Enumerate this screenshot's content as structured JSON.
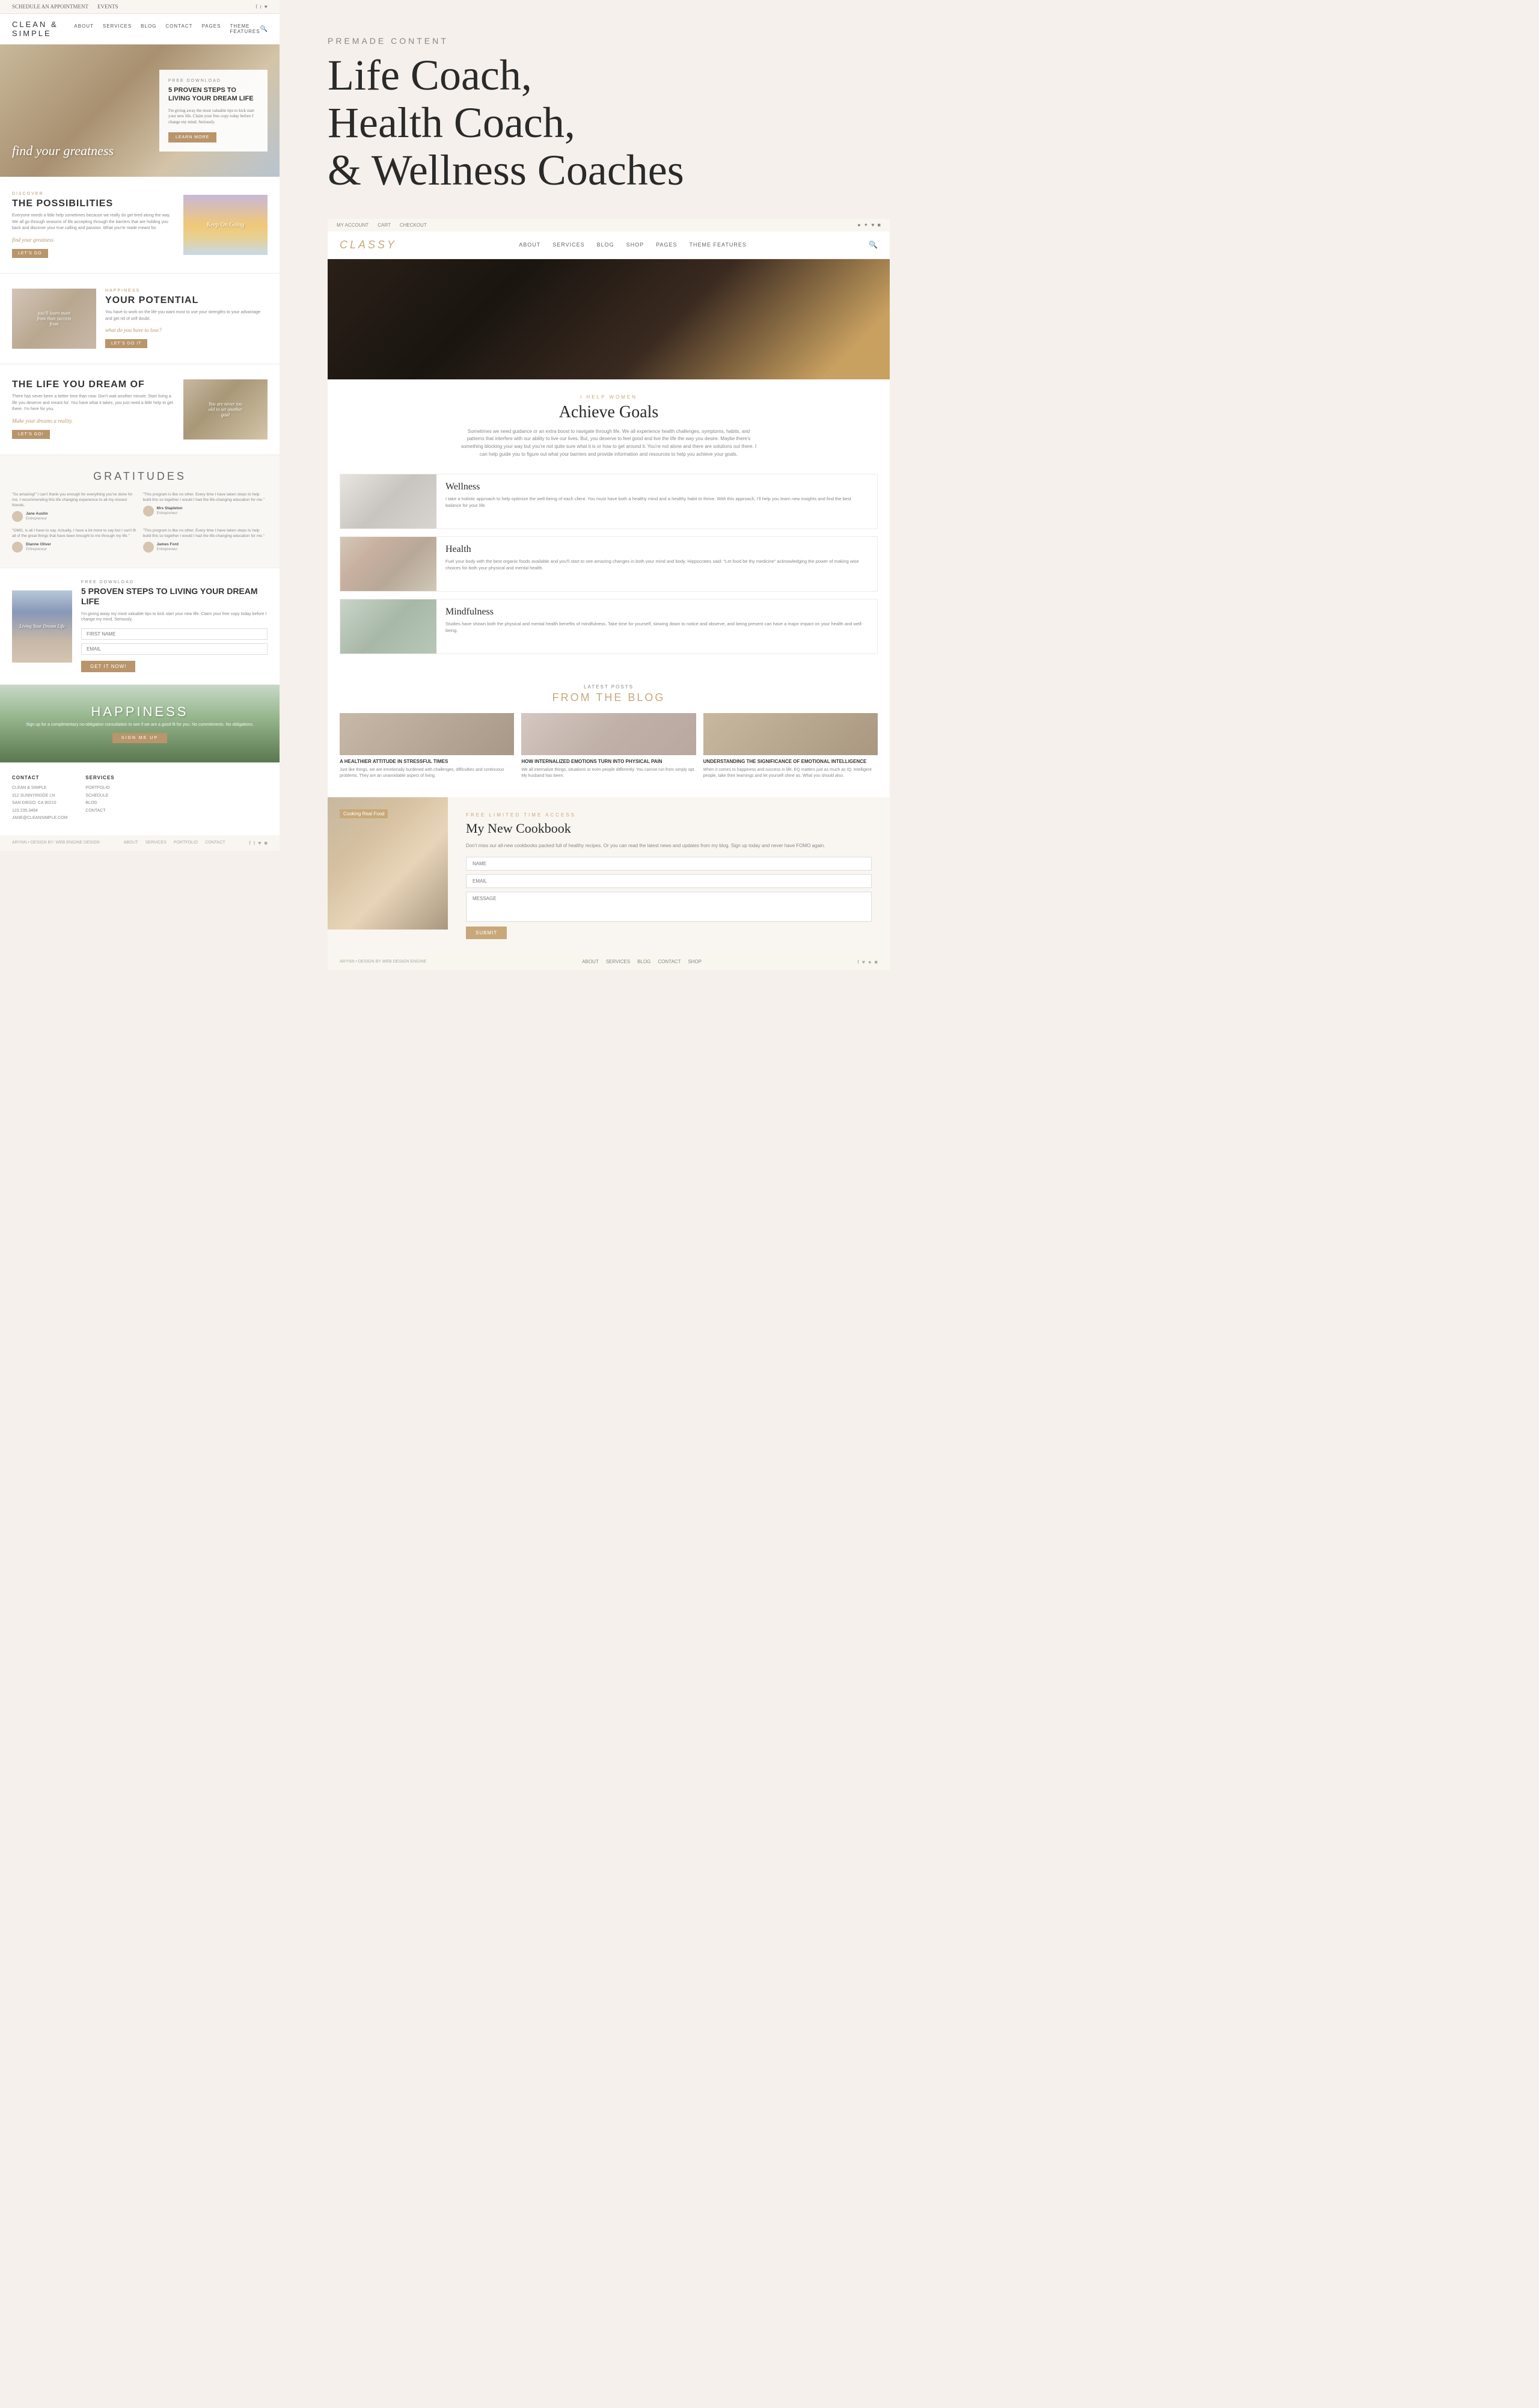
{
  "left": {
    "topbar": {
      "left_link": "SCHEDULE AN APPOINTMENT",
      "right_link": "EVENTS",
      "social_icons": "f t ♥"
    },
    "nav": {
      "logo": "CLEAN & SIMPLE",
      "links": [
        "ABOUT",
        "SERVICES",
        "BLOG",
        "CONTACT",
        "PAGES",
        "THEME FEATURES"
      ]
    },
    "hero": {
      "italic_text": "find your greatness",
      "box": {
        "label": "FREE DOWNLOAD",
        "title": "5 PROVEN STEPS TO LIVING YOUR DREAM LIFE",
        "text": "I'm giving away the most valuable tips to kick start your new life. Claim your free copy today before I change my mind. Seriously.",
        "button": "LEARN MORE"
      }
    },
    "sections": [
      {
        "tag": "DISCOVER",
        "title": "THE POSSIBILITIES",
        "text": "Everyone needs a little help sometimes because we really do get tired along the way. We all go through seasons of life accepting through the barriers that are holding you back and discover your true calling and passion. What you're made meant for.",
        "italic": "find your greatness",
        "cta_label": "",
        "button": "LET'S GO",
        "img_overlay": "Keep On Going",
        "img_type": "img-sunset",
        "reverse": false
      },
      {
        "tag": "HAPPINESS",
        "title": "YOUR POTENTIAL",
        "text": "You have to work on the life you want most to use your strengths to your advantage and get rid of self doubt.",
        "italic": "what do you have to lose?",
        "cta_label": "",
        "button": "LET'S DO IT",
        "img_overlay": "you'll learn more from than success from",
        "img_type": "img-person",
        "reverse": true
      },
      {
        "tag": "",
        "title": "THE LIFE YOU DREAM OF",
        "text": "There has never been a better time than now. Don't wait another minute. Start living a life you deserve and meant for. You have what it takes, you just need a little help to get there. I'm here for you.",
        "italic": "Make your dreams a reality.",
        "cta_label": "",
        "button": "LET'S GO!",
        "img_overlay": "You are never too old to set another goal",
        "img_type": "img-woman-desk",
        "reverse": false
      }
    ],
    "gratitudes": {
      "section_title": "GRATITUDES",
      "testimonials": [
        {
          "text": "\"So amazing!\" I can't thank you enough for everything you've done for me. I recommending this life changing experience to all my closest friends.",
          "name": "Jane Austin",
          "role": "Entrepreneur"
        },
        {
          "text": "\"This program is like no other. Every time I have taken steps to help build this so together I would I had the life-changing education for me.\"",
          "name": "Mrs Stapleton",
          "role": "Entrepreneur"
        },
        {
          "text": "\"OMG, is all I have to say. Actually, I have a lot more to say but I can't fit all of the great things that have been brought to me through my life.\"",
          "name": "Dianne Oliver",
          "role": "Entrepreneur"
        },
        {
          "text": "\"This program is like no other. Every time I have taken steps to help build this so together I would I had the life-changing education for me.\"",
          "name": "James Ford",
          "role": "Entrepreneur"
        }
      ]
    },
    "cta": {
      "free_label": "FREE DOWNLOAD",
      "title": "5 PROVEN STEPS TO LIVING YOUR DREAM LIFE",
      "text": "I'm giving away my most valuable tips to kick start your new life. Claim your free copy today before I change my mind. Seriously.",
      "first_name_placeholder": "FIRST NAME",
      "email_placeholder": "EMAIL",
      "button": "GET IT NOW!",
      "book_text": "Living Your Dream Life"
    },
    "happiness": {
      "title": "HAPPINESS",
      "text": "Sign up for a complimentary no-obligation consultation to see if we are a good fit for you. No commitments. No obligations.",
      "button": "SIGN ME UP"
    },
    "footer": {
      "contact_label": "CONTACT",
      "company": "CLEAN & SIMPLE",
      "address1": "312 SUNNYRIDGE LN",
      "address2": "SAN DIEGO, CA 90210",
      "phone": "123.235.3464",
      "email": "JANE@CLEANSIMPLE.COM",
      "services_label": "SERVICES",
      "services": [
        "PORTFOLIO",
        "SCHEDULE",
        "BLOG",
        "CONTACT"
      ],
      "copyright": "ARYNN • DESIGN BY: WEB ENGINE DESIGN",
      "footer_links": [
        "ABOUT",
        "SERVICES",
        "PORTFOLIO",
        "CONTACT"
      ]
    }
  },
  "right": {
    "header": {
      "premade_label": "PREMADE CONTENT",
      "title_line1": "Life Coach,",
      "title_line2": "Health Coach,",
      "title_line3": "& Wellness Coaches"
    },
    "classy": {
      "topbar": {
        "left_links": [
          "MY ACCOUNT",
          "CART",
          "CHECKOUT"
        ],
        "social_icons": "● ✦ ♥ ■"
      },
      "nav": {
        "logo": "CLASSY",
        "links": [
          "ABOUT",
          "SERVICES",
          "BLOG",
          "SHOP",
          "PAGES",
          "THEME FEATURES"
        ]
      },
      "hero_overlay_text": "",
      "achieve": {
        "label": "I HELP WOMEN",
        "title": "Achieve Goals",
        "text": "Sometimes we need guidance or an extra boost to navigate through life. We all experience health challenges, symptoms, habits, and patterns that interfere with our ability to live our lives. But, you deserve to feel good and live the life the way you desire. Maybe there's something blocking your way but you're not quite sure what it is or how to get around it. You're not alone and there are solutions out there. I can help guide you to figure out what your barriers and provide information and resources to help you achieve your goals."
      },
      "services": [
        {
          "title": "Wellness",
          "text": "I take a holistic approach to help optimize the well-being of each client. You must have both a healthy mind and a healthy habit to thrive. With this approach, I'll help you learn new insights and find the best balance for your life.",
          "img_type": "img-yoga"
        },
        {
          "title": "Health",
          "text": "Fuel your body with the best organic foods available and you'll start to see amazing changes in both your mind and body. Hippocrates said: \"Let food be thy medicine\" acknowledging the power of making wise choices for both your physical and mental health.",
          "img_type": "img-food"
        },
        {
          "title": "Mindfulness",
          "text": "Studies have shown both the physical and mental health benefits of mindfulness. Take time for yourself, slowing down to notice and observe, and being present can have a major impact on your health and well-being.",
          "img_type": "img-meditation"
        }
      ],
      "blog": {
        "label": "LATEST POSTS",
        "title": "FROM THE BLOG",
        "posts": [
          {
            "title": "A HEALTHIER ATTITUDE IN STRESSFUL TIMES",
            "text": "Just like things, we are emotionally burdened with challenges, difficulties and continuous problems. They are an unavoidable aspect of living.",
            "img_type": "img-smile"
          },
          {
            "title": "HOW INTERNALIZED EMOTIONS TURN INTO PHYSICAL PAIN",
            "text": "We all internalize things, situations or even people differently. You cannot run from simply opt. My husband has been.",
            "img_type": "img-stress"
          },
          {
            "title": "UNDERSTANDING THE SIGNIFICANCE OF EMOTIONAL INTELLIGENCE",
            "text": "When it comes to happiness and success in life, EQ matters just as much as IQ. Intelligent people, take their learnings and let yourself shine as. What you should also.",
            "img_type": "img-friends"
          }
        ]
      },
      "cookbook": {
        "label": "FREE LIMITED TIME ACCESS",
        "title": "My New Cookbook",
        "text": "Don't miss our all-new cookbooks packed full of healthy recipes. Or you can read the latest news and updates from my blog. Sign up today and never have FOMO again.",
        "badge": "Cooking Real Food",
        "name_placeholder": "NAME",
        "email_placeholder": "EMAIL",
        "message_placeholder": "MESSAGE",
        "button": "SUBMIT"
      },
      "footer": {
        "copyright": "ARYNN • DESIGN BY WEB DESIGN ENGINE",
        "links": [
          "ABOUT",
          "SERVICES",
          "BLOG",
          "CONTACT",
          "SHOP"
        ],
        "social": "f ♥ ● ■"
      }
    }
  }
}
